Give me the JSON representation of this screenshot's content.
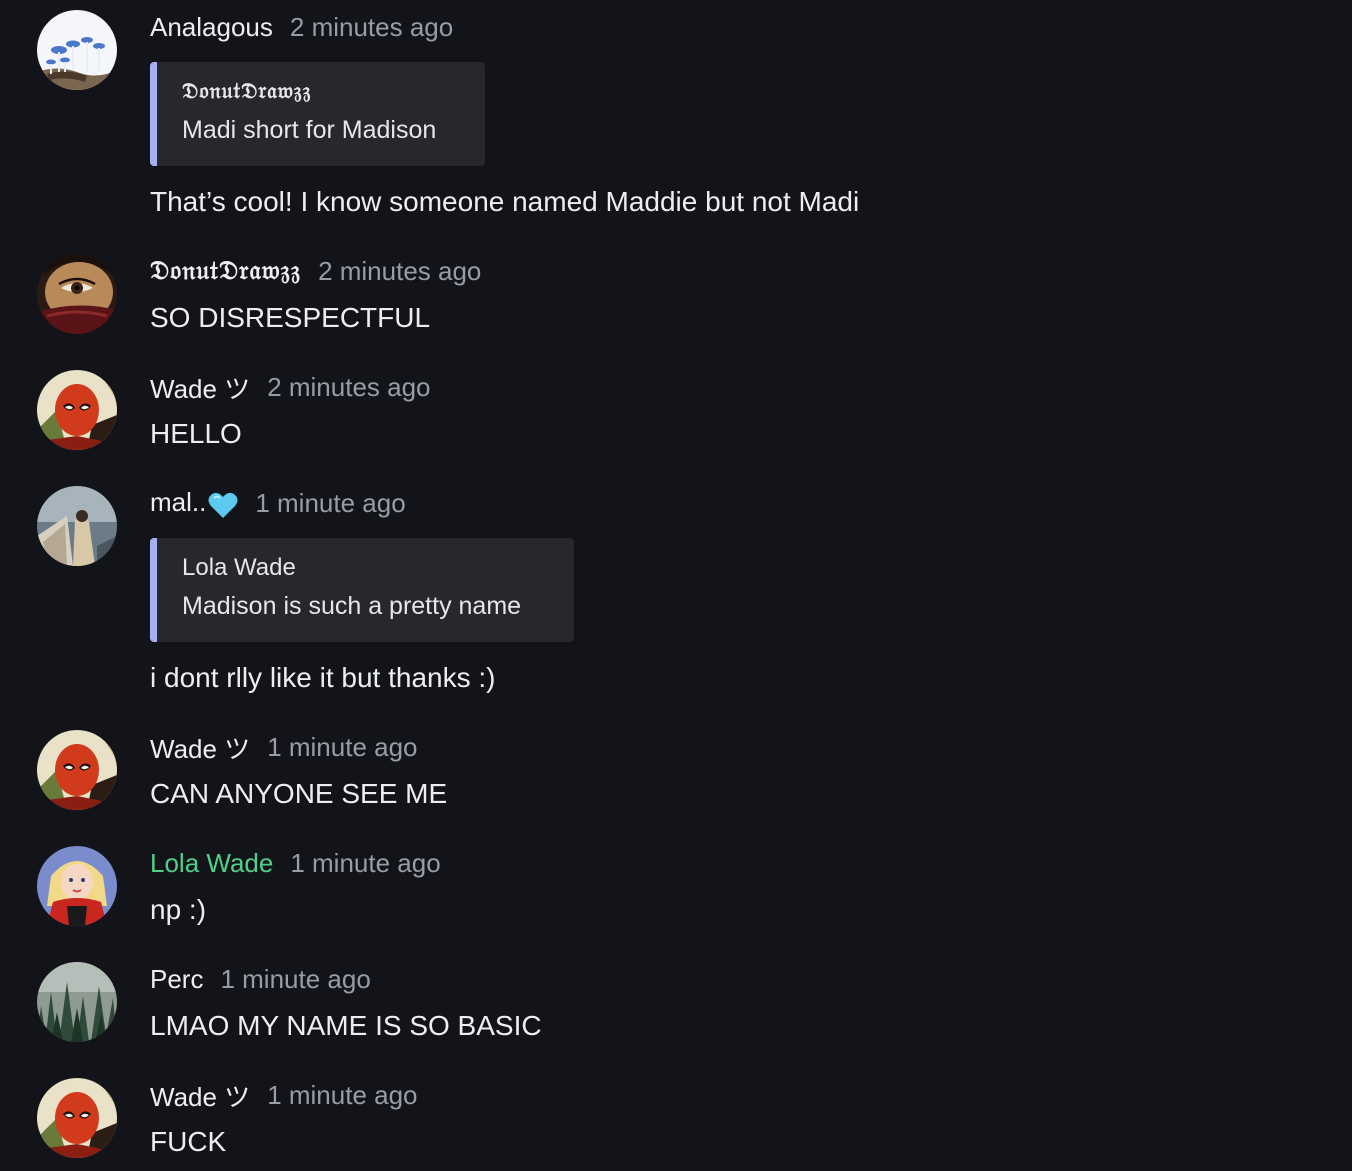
{
  "messages": [
    {
      "author": "Analagous",
      "time": "2 minutes ago",
      "avatar_icon": "mushroom-avatar",
      "reply": {
        "author": "𝔇𝔬𝔫𝔲𝔱𝔇𝔯𝔞𝔴𝔷𝔷",
        "text": "Madi short for Madison"
      },
      "text": "That’s cool! I know someone named Maddie but not Madi"
    },
    {
      "author": "𝔇𝔬𝔫𝔲𝔱𝔇𝔯𝔞𝔴𝔷𝔷",
      "time": "2 minutes ago",
      "avatar_icon": "face-eye-avatar",
      "text": "SO DISRESPECTFUL"
    },
    {
      "author": "Wade ツ",
      "time": "2 minutes ago",
      "avatar_icon": "deadpool-avatar",
      "text": "HELLO"
    },
    {
      "author": "mal..",
      "author_emoji": "light-blue-heart-icon",
      "time": "1 minute ago",
      "avatar_icon": "person-photo-avatar",
      "reply": {
        "author": "Lola Wade",
        "text": "Madison is such a pretty name"
      },
      "text": "i dont rlly like it but thanks :)"
    },
    {
      "author": "Wade ツ",
      "time": "1 minute ago",
      "avatar_icon": "deadpool-avatar",
      "text": "CAN ANYONE SEE ME"
    },
    {
      "author": "Lola Wade",
      "author_color": "#4fd08a",
      "time": "1 minute ago",
      "avatar_icon": "lady-deadpool-avatar",
      "text": "np :)"
    },
    {
      "author": "Perc",
      "time": "1 minute ago",
      "avatar_icon": "forest-avatar",
      "text": "LMAO MY NAME IS SO BASIC"
    },
    {
      "author": "Wade ツ",
      "time": "1 minute ago",
      "avatar_icon": "deadpool-avatar",
      "text": "FUCK"
    }
  ],
  "colors": {
    "background": "#131419",
    "quote_bg": "#27282e",
    "quote_bar": "#a8b2f2",
    "timestamp": "#9a9ca5",
    "role_green": "#4fd08a"
  }
}
